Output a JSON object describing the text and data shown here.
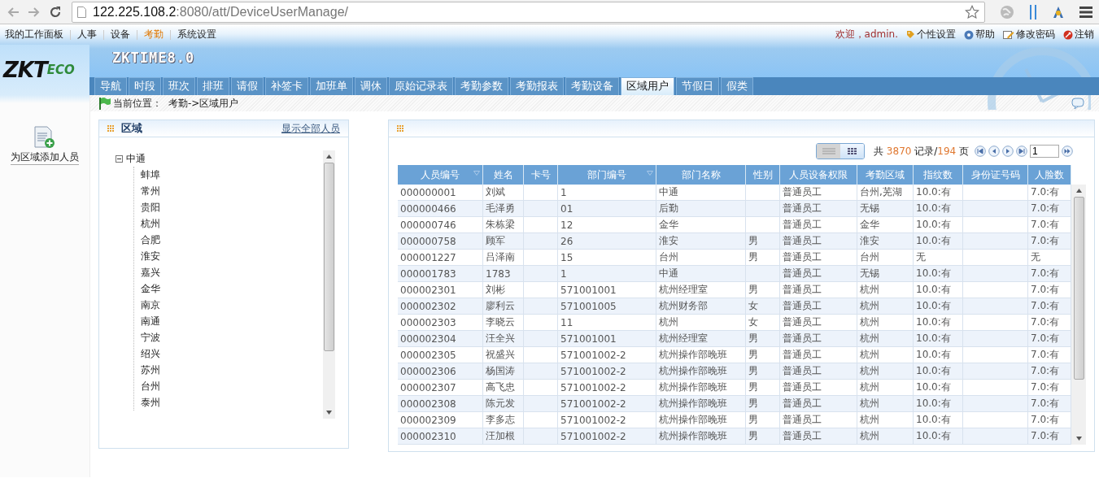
{
  "browser": {
    "url_host": "122.225.108.2",
    "url_rest": ":8080/att/DeviceUserManage/"
  },
  "top_nav": [
    {
      "label": "我的工作面板",
      "selected": false
    },
    {
      "label": "人事",
      "selected": false
    },
    {
      "label": "设备",
      "selected": false
    },
    {
      "label": "考勤",
      "selected": true
    },
    {
      "label": "系统设置",
      "selected": false
    }
  ],
  "user_bar": {
    "welcome": "欢迎，admin.",
    "links": [
      {
        "kind": "personalize",
        "label": "个性设置"
      },
      {
        "kind": "help",
        "label": "帮助"
      },
      {
        "kind": "password",
        "label": "修改密码"
      },
      {
        "kind": "logout",
        "label": "注销"
      }
    ]
  },
  "logo": {
    "main": "ZKT",
    "sub": "ECO"
  },
  "product": "ZKTIME8.0",
  "tabs": [
    {
      "label": "导航",
      "selected": false
    },
    {
      "label": "时段",
      "selected": false
    },
    {
      "label": "班次",
      "selected": false
    },
    {
      "label": "排班",
      "selected": false
    },
    {
      "label": "请假",
      "selected": false
    },
    {
      "label": "补签卡",
      "selected": false
    },
    {
      "label": "加班单",
      "selected": false
    },
    {
      "label": "调休",
      "selected": false
    },
    {
      "label": "原始记录表",
      "selected": false
    },
    {
      "label": "考勤参数",
      "selected": false
    },
    {
      "label": "考勤报表",
      "selected": false
    },
    {
      "label": "考勤设备",
      "selected": false
    },
    {
      "label": "区域用户",
      "selected": true
    },
    {
      "label": "节假日",
      "selected": false
    },
    {
      "label": "假类",
      "selected": false
    }
  ],
  "breadcrumb": {
    "label": "当前位置：",
    "path": "考勤->区域用户"
  },
  "sidebar": {
    "action": "为区域添加人员"
  },
  "area_panel": {
    "title": "区域",
    "link": "显示全部人员",
    "tree": [
      {
        "label": "中通",
        "expanded": true,
        "children": [
          {
            "label": "蚌埠"
          },
          {
            "label": "常州"
          },
          {
            "label": "贵阳"
          },
          {
            "label": "杭州"
          },
          {
            "label": "合肥"
          },
          {
            "label": "淮安"
          },
          {
            "label": "嘉兴"
          },
          {
            "label": "金华"
          },
          {
            "label": "南京"
          },
          {
            "label": "南通"
          },
          {
            "label": "宁波"
          },
          {
            "label": "绍兴"
          },
          {
            "label": "苏州"
          },
          {
            "label": "台州"
          },
          {
            "label": "泰州"
          }
        ]
      }
    ]
  },
  "table_panel": {
    "view_modes": [
      {
        "kind": "list",
        "selected": true
      },
      {
        "kind": "grid",
        "selected": false
      }
    ],
    "pager": {
      "prefix": "共",
      "records": "3870",
      "records_label": "记录/",
      "pages": "194",
      "pages_label": "页",
      "page": "1"
    },
    "columns": [
      {
        "label": "人员编号",
        "sortable": true
      },
      {
        "label": "姓名",
        "sortable": false
      },
      {
        "label": "卡号",
        "sortable": false
      },
      {
        "label": "部门编号",
        "sortable": true
      },
      {
        "label": "部门名称",
        "sortable": false
      },
      {
        "label": "性别",
        "sortable": false
      },
      {
        "label": "人员设备权限",
        "sortable": false
      },
      {
        "label": "考勤区域",
        "sortable": false
      },
      {
        "label": "指纹数",
        "sortable": false
      },
      {
        "label": "身份证号码",
        "sortable": false
      },
      {
        "label": "人脸数",
        "sortable": false
      }
    ],
    "rows": [
      [
        "000000001",
        "刘斌",
        null,
        "1",
        "中通",
        null,
        "普通员工",
        "台州,芜湖",
        "10.0:有",
        null,
        "7.0:有"
      ],
      [
        "000000466",
        "毛泽勇",
        null,
        "01",
        "后勤",
        null,
        "普通员工",
        "无锡",
        "10.0:有",
        null,
        "7.0:有"
      ],
      [
        "000000746",
        "朱栋梁",
        null,
        "12",
        "金华",
        null,
        "普通员工",
        "金华",
        "10.0:有",
        null,
        "7.0:有"
      ],
      [
        "000000758",
        "顾军",
        null,
        "26",
        "淮安",
        "男",
        "普通员工",
        "淮安",
        "10.0:有",
        null,
        "7.0:有"
      ],
      [
        "000001227",
        "吕泽南",
        null,
        "15",
        "台州",
        "男",
        "普通员工",
        "台州",
        "无",
        null,
        "无"
      ],
      [
        "000001783",
        "1783",
        null,
        "1",
        "中通",
        null,
        "普通员工",
        "无锡",
        "10.0:有",
        null,
        "7.0:有"
      ],
      [
        "000002301",
        "刘彬",
        null,
        "571001001",
        "杭州经理室",
        "男",
        "普通员工",
        "杭州",
        "10.0:有",
        null,
        "7.0:有"
      ],
      [
        "000002302",
        "廖利云",
        null,
        "571001005",
        "杭州财务部",
        "女",
        "普通员工",
        "杭州",
        "10.0:有",
        null,
        "7.0:有"
      ],
      [
        "000002303",
        "李晓云",
        null,
        "11",
        "杭州",
        "女",
        "普通员工",
        "杭州",
        "10.0:有",
        null,
        "7.0:有"
      ],
      [
        "000002304",
        "汪全兴",
        null,
        "571001001",
        "杭州经理室",
        "男",
        "普通员工",
        "杭州",
        "10.0:有",
        null,
        "7.0:有"
      ],
      [
        "000002305",
        "祝盛兴",
        null,
        "571001002-2",
        "杭州操作部晚班",
        "男",
        "普通员工",
        "杭州",
        "10.0:有",
        null,
        "7.0:有"
      ],
      [
        "000002306",
        "杨国涛",
        null,
        "571001002-2",
        "杭州操作部晚班",
        "男",
        "普通员工",
        "杭州",
        "10.0:有",
        null,
        "7.0:有"
      ],
      [
        "000002307",
        "高飞忠",
        null,
        "571001002-2",
        "杭州操作部晚班",
        "男",
        "普通员工",
        "杭州",
        "10.0:有",
        null,
        "7.0:有"
      ],
      [
        "000002308",
        "陈元发",
        null,
        "571001002-2",
        "杭州操作部晚班",
        "男",
        "普通员工",
        "杭州",
        "10.0:有",
        null,
        "7.0:有"
      ],
      [
        "000002309",
        "李多志",
        null,
        "571001002-2",
        "杭州操作部晚班",
        "男",
        "普通员工",
        "杭州",
        "10.0:有",
        null,
        "7.0:有"
      ],
      [
        "000002310",
        "汪加根",
        null,
        "571001002-2",
        "杭州操作部晚班",
        "男",
        "普通员工",
        "杭州",
        "10.0:有",
        null,
        "7.0:有"
      ]
    ]
  }
}
